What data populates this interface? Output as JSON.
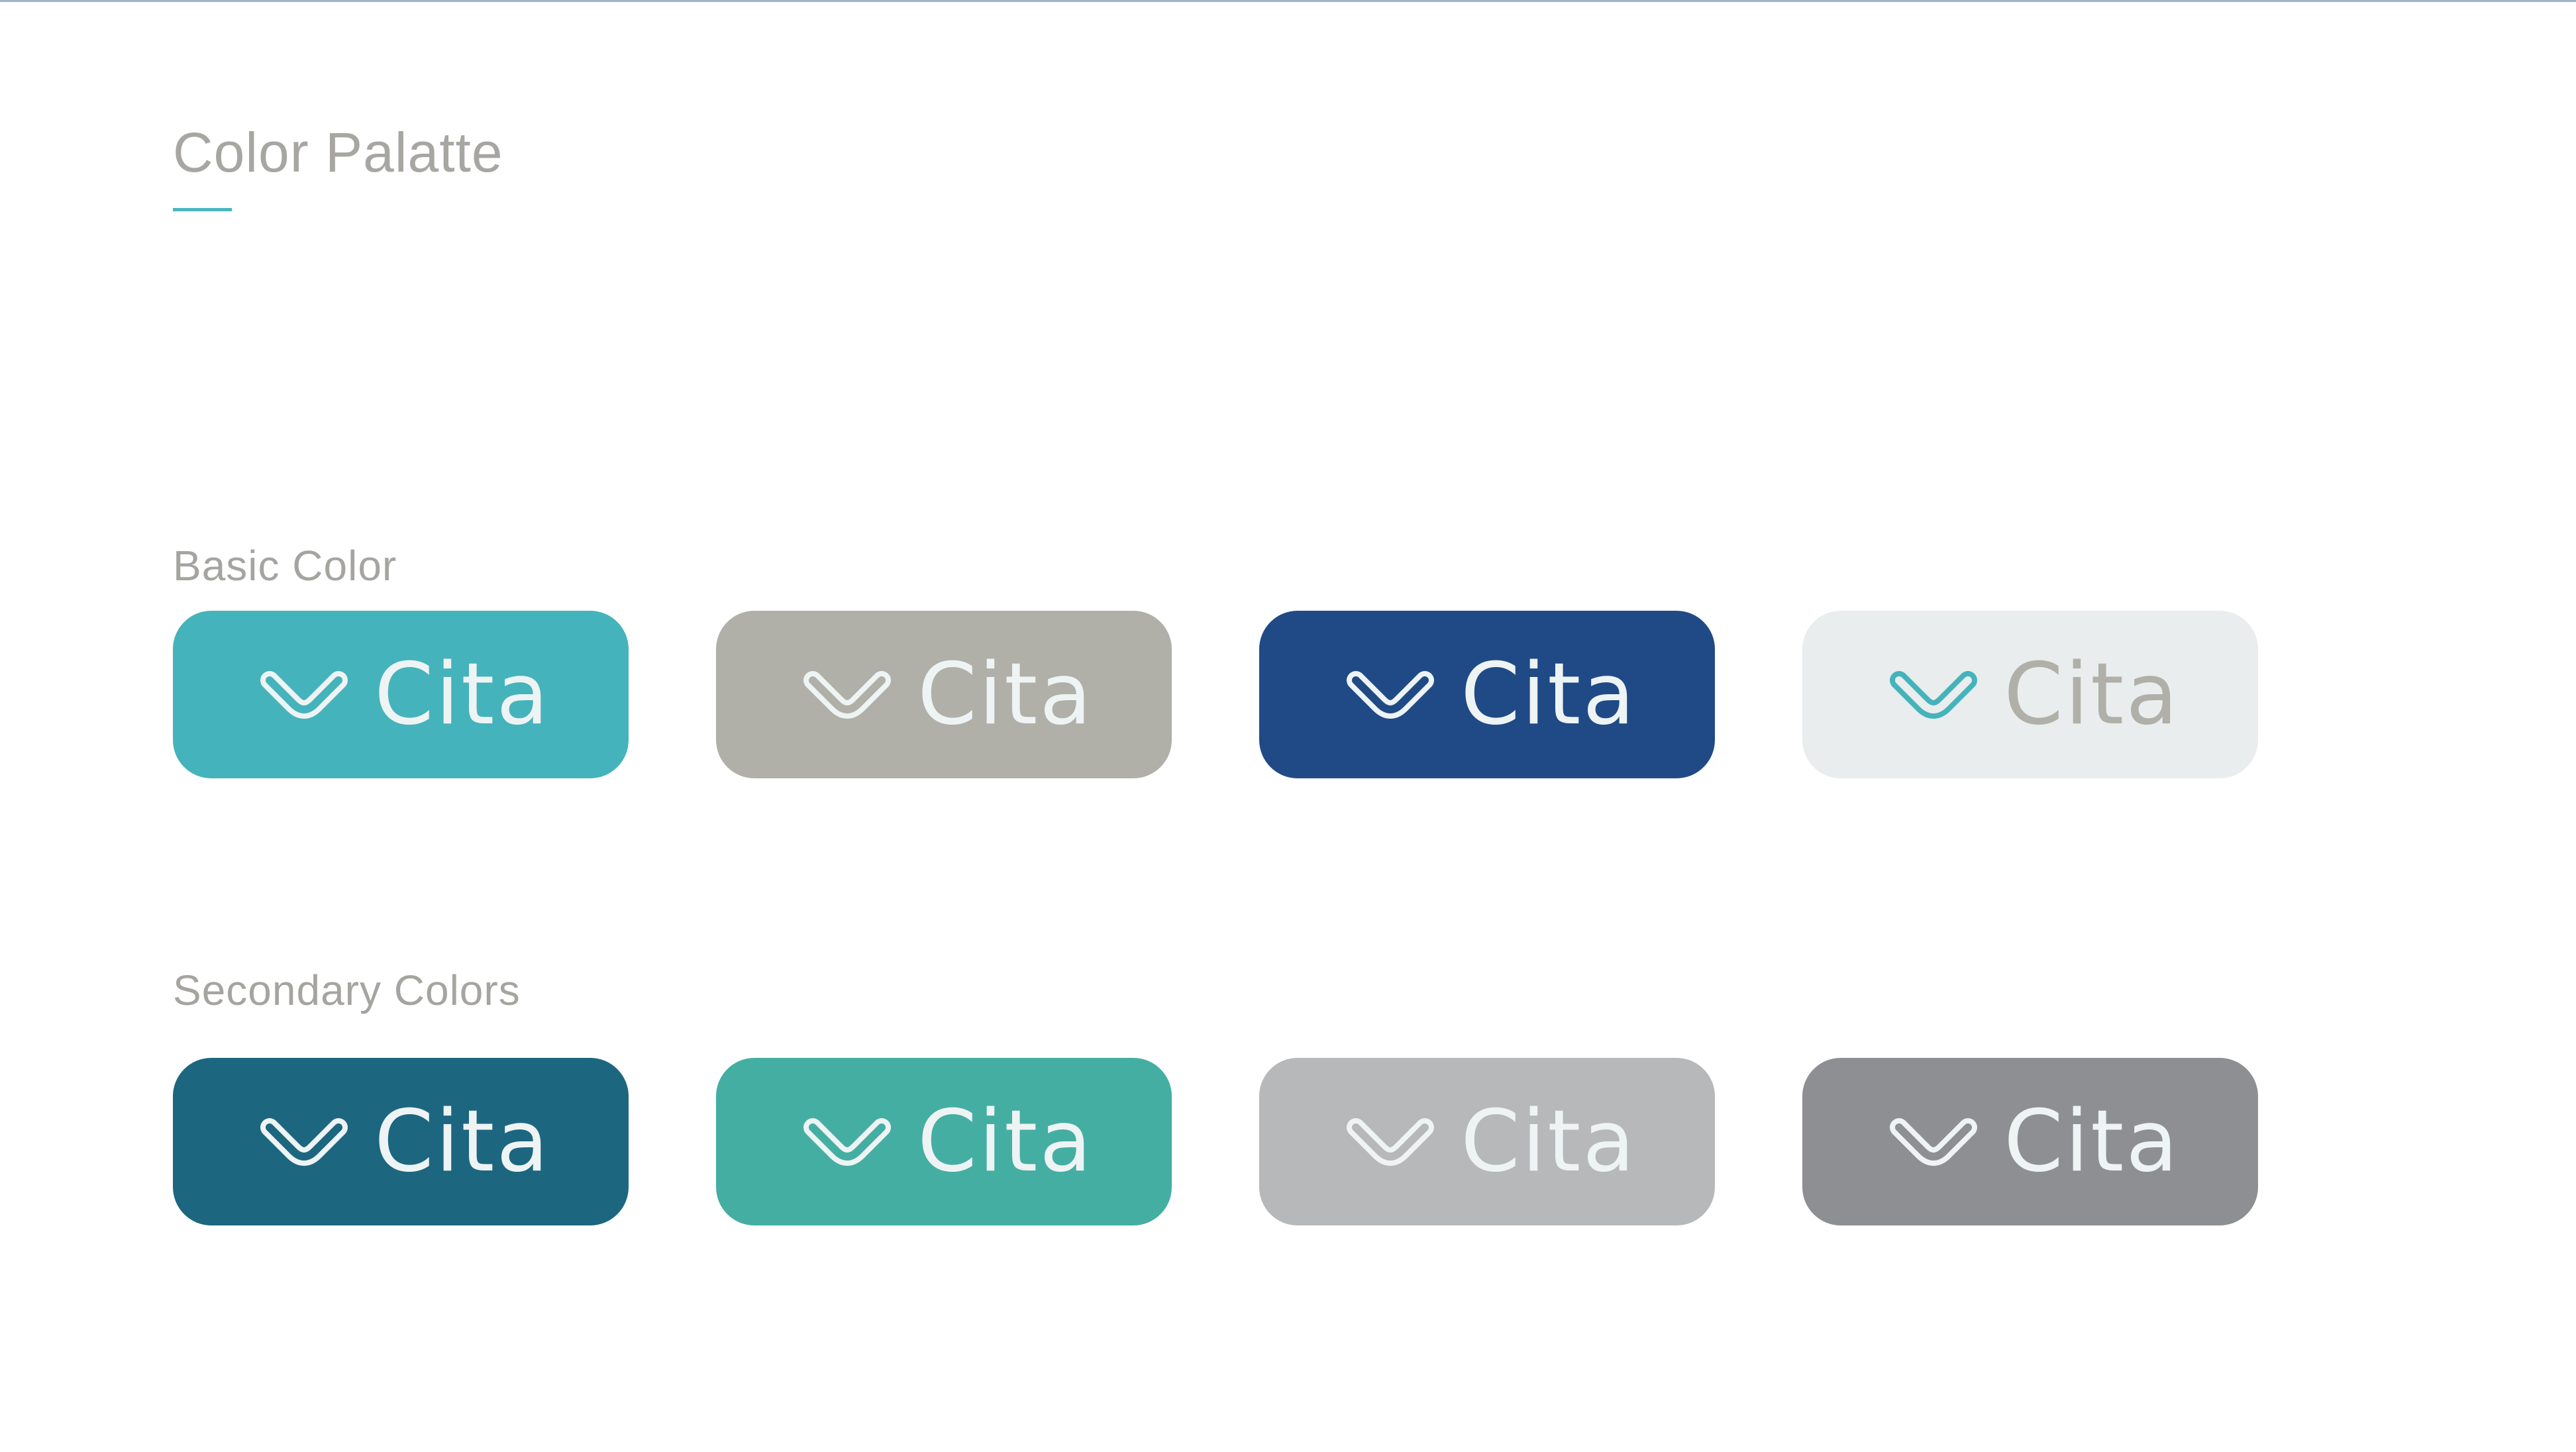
{
  "page": {
    "title": "Color Palatte",
    "accent": "#4ab5c0"
  },
  "sections": [
    {
      "label": "Basic Color",
      "swatches": [
        {
          "brand": "Cita",
          "background": "#45b3bb",
          "icon_color": "#eef3f4",
          "text_color": "#eef3f4"
        },
        {
          "brand": "Cita",
          "background": "#b0b0a8",
          "icon_color": "#eef3f4",
          "text_color": "#eef3f4"
        },
        {
          "brand": "Cita",
          "background": "#204a86",
          "icon_color": "#eef3f4",
          "text_color": "#eef3f4"
        },
        {
          "brand": "Cita",
          "background": "#e9eded",
          "icon_color": "#45b3bb",
          "text_color": "#b0b0a8"
        }
      ]
    },
    {
      "label": "Secondary Colors",
      "swatches": [
        {
          "brand": "Cita",
          "background": "#1d6680",
          "icon_color": "#eef3f4",
          "text_color": "#eef3f4"
        },
        {
          "brand": "Cita",
          "background": "#44aea2",
          "icon_color": "#eef3f4",
          "text_color": "#eef3f4"
        },
        {
          "brand": "Cita",
          "background": "#b7b8ba",
          "icon_color": "#eef3f4",
          "text_color": "#eef3f4"
        },
        {
          "brand": "Cita",
          "background": "#8e8f92",
          "icon_color": "#eef3f4",
          "text_color": "#eef3f4"
        }
      ]
    }
  ]
}
